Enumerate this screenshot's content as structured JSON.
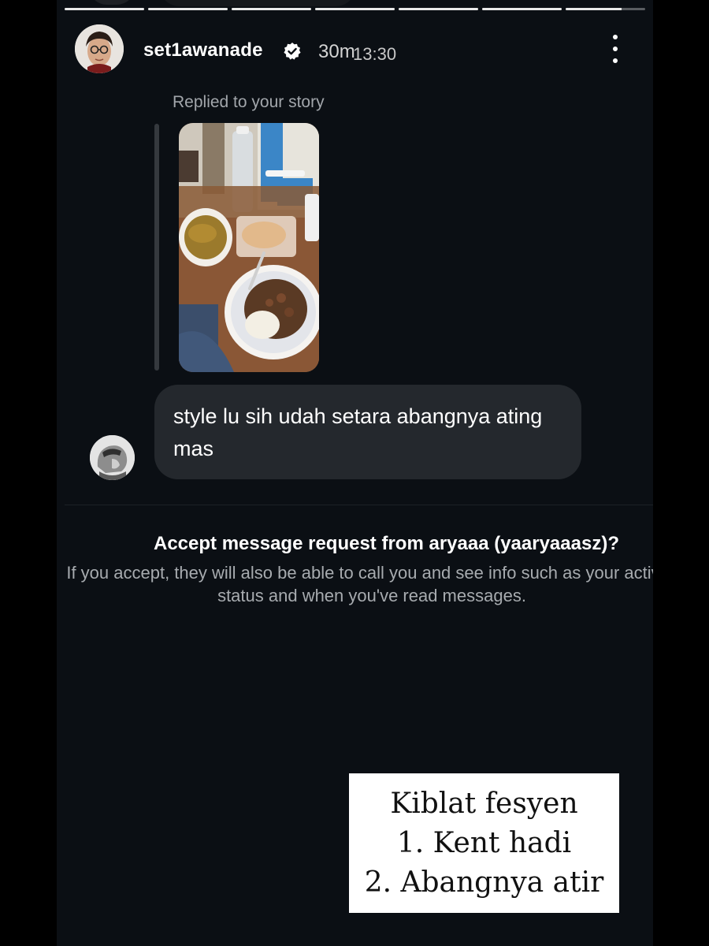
{
  "story": {
    "progress_segments": [
      1,
      1,
      1,
      1,
      1,
      1,
      0.7
    ]
  },
  "header": {
    "username": "set1awanade",
    "verified_icon": "verified-badge-icon",
    "time_ago": "30m",
    "overlay_time": "13:30",
    "more_icon": "more-vertical-icon"
  },
  "message": {
    "replied_label": "Replied to your story",
    "story_thumbnail_icon": "story-photo-thumbnail",
    "text": "style lu sih udah setara abangnya ating mas"
  },
  "request": {
    "title": "Accept message request from aryaaa (yaaryaaasz)?",
    "body": "If you accept, they will also be able to call you and see info such as your activity status and when you've read messages."
  },
  "caption": {
    "line1": "Kiblat fesyen",
    "line2": "1. Kent hadi",
    "line3": "2. Abangnya atir"
  },
  "colors": {
    "background": "#0b0f14",
    "bubble": "#24282d",
    "text": "#ffffff",
    "muted": "#a7abaf"
  }
}
